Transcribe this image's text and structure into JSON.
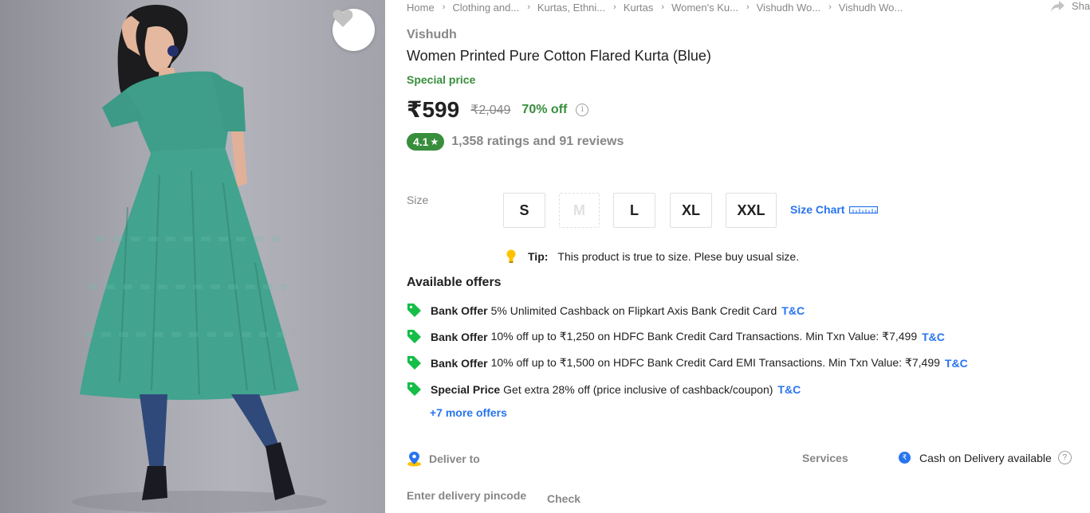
{
  "breadcrumb": [
    "Home",
    "Clothing and...",
    "Kurtas, Ethni...",
    "Kurtas",
    "Women's Ku...",
    "Vishudh Wo...",
    "Vishudh Wo..."
  ],
  "share_label": "Sha",
  "product": {
    "brand": "Vishudh",
    "title": "Women Printed Pure Cotton Flared Kurta  (Blue)",
    "special_label": "Special price",
    "price": "₹599",
    "mrp": "₹2,049",
    "discount": "70% off",
    "info_glyph": "i",
    "rating": "4.1",
    "rating_star": "★",
    "ratings_text": "1,358 ratings and 91 reviews"
  },
  "size": {
    "label": "Size",
    "options": [
      "S",
      "M",
      "L",
      "XL",
      "XXL"
    ],
    "unavailable": [
      "M"
    ],
    "chart_label": "Size Chart",
    "tip_label": "Tip:",
    "tip_text": "This product is true to size. Plese buy usual size."
  },
  "offers": {
    "heading": "Available offers",
    "items": [
      {
        "type": "Bank Offer",
        "text": "5% Unlimited Cashback on Flipkart Axis Bank Credit Card",
        "link": "T&C"
      },
      {
        "type": "Bank Offer",
        "text": "10% off up to ₹1,250 on HDFC Bank Credit Card Transactions. Min Txn Value: ₹7,499",
        "link": "T&C"
      },
      {
        "type": "Bank Offer",
        "text": "10% off up to ₹1,500 on HDFC Bank Credit Card EMI Transactions. Min Txn Value: ₹7,499",
        "link": "T&C"
      },
      {
        "type": "Special Price",
        "text": "Get extra 28% off (price inclusive of cashback/coupon)",
        "link": "T&C"
      }
    ],
    "more": "+7 more offers"
  },
  "delivery": {
    "label": "Deliver to",
    "pincode_placeholder": "Enter delivery pincode",
    "check_label": "Check"
  },
  "services": {
    "label": "Services",
    "cod": "Cash on Delivery available",
    "cod_glyph": "₹",
    "help_glyph": "?"
  },
  "colors": {
    "accent_blue": "#2874f0",
    "green": "#388e3c",
    "muted_text": "#878787",
    "kurta": "#3f9e8a"
  },
  "icons": [
    "heart-icon",
    "share-icon",
    "info-icon",
    "star-icon",
    "ruler-icon",
    "bulb-icon",
    "tag-icon",
    "location-pin-icon",
    "rupee-icon",
    "help-icon"
  ]
}
